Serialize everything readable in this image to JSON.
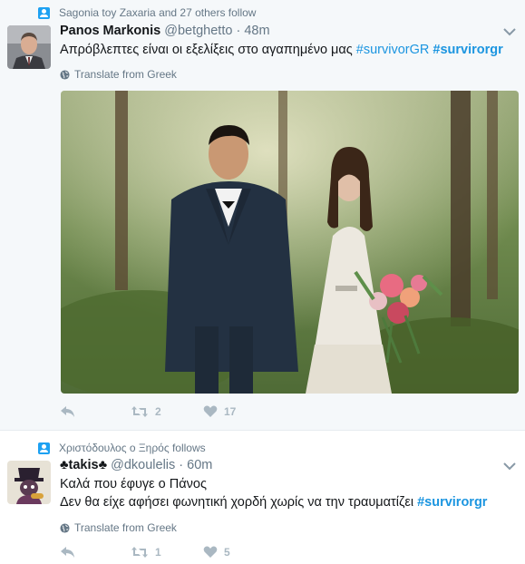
{
  "colors": {
    "link": "#1b95e0",
    "muted": "#657786",
    "action": "#aab8c2",
    "bg_tweet1": "#f5f8fa"
  },
  "tweets": [
    {
      "context": "Sagonia toy Zaxaria and 27 others follow",
      "name": "Panos Markonis",
      "handle": "@betghetto",
      "time": "· 48m",
      "text_plain": "Απρόβλεπτες είναι οι εξελίξεις στο αγαπημένο μας ",
      "hashtag1": "#survivorGR",
      "hashtag2": "#survirorgr",
      "translate": "Translate from Greek",
      "media_icon": "wedding-photo",
      "reply_icon": "reply-icon",
      "retweets": "2",
      "likes": "17"
    },
    {
      "context": "Χριστόδουλος ο Ξηρός follows",
      "name_prefix": "♣",
      "name": "takis",
      "name_suffix": "♣",
      "handle": "@dkoulelis",
      "time": "· 60m",
      "line1": "Καλά που έφυγε ο Πάνος",
      "line2_plain": "Δεν θα είχε αφήσει φωνητική χορδή χωρίς να την τραυματίζει ",
      "hashtag": "#survirorgr",
      "translate": "Translate from Greek",
      "retweets": "1",
      "likes": "5"
    }
  ]
}
